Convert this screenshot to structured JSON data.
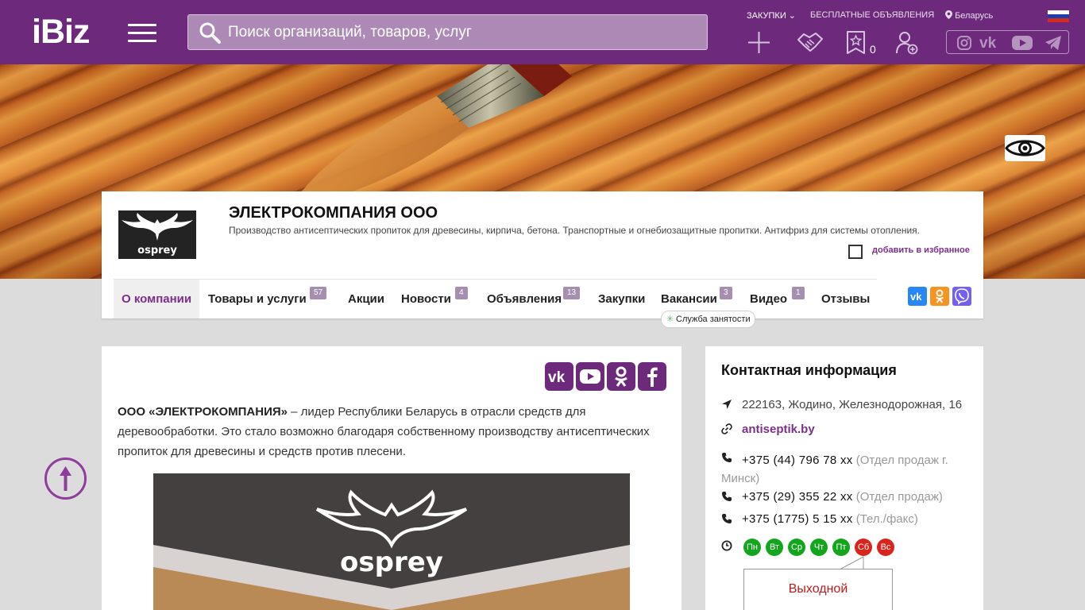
{
  "header": {
    "logo": "iBiz",
    "search_placeholder": "Поиск организаций, товаров, услуг",
    "zakupki": "ЗАКУПКИ",
    "free_ads": "БЕСПЛАТНЫЕ ОБЪЯВЛЕНИЯ",
    "region": "Беларусь",
    "favorites_count": "0",
    "social_icons": [
      "instagram-icon",
      "vk-icon",
      "youtube-icon",
      "telegram-icon"
    ]
  },
  "company": {
    "name": "ЭЛЕКТРОКОМПАНИЯ ООО",
    "logo_text": "osprey",
    "description": "Производство антисептических пропиток для древесины, кирпича, бетона. Транспортные и огнебиозащитные пропитки. Антифриз для системы отопления.",
    "add_favorite": "добавить в избранное",
    "tabs": [
      {
        "label": "О компании",
        "badge": ""
      },
      {
        "label": "Товары и услуги",
        "badge": "57"
      },
      {
        "label": "Акции",
        "badge": ""
      },
      {
        "label": "Новости",
        "badge": "4"
      },
      {
        "label": "Объявления",
        "badge": "13"
      },
      {
        "label": "Закупки",
        "badge": ""
      },
      {
        "label": "Вакансии",
        "badge": "3"
      },
      {
        "label": "Видео",
        "badge": "1"
      },
      {
        "label": "Отзывы",
        "badge": ""
      }
    ],
    "employment_service": "Служба занятости"
  },
  "about": {
    "intro_bold": "ООО «ЭЛЕКТРОКОМПАНИЯ»",
    "intro_rest": " – лидер Республики Беларусь в отрасли средств для деревообработки. Это стало возможно благодаря собственному производству антисептических пропиток для древесины и средств против плесени.",
    "image_text": "osprey"
  },
  "contacts": {
    "title": "Контактная информация",
    "address": "222163, Жодино, Железнодорожная, 16",
    "site": "antiseptik.by",
    "phones": [
      {
        "number": "+375 (44) 796 78 xx",
        "note": "(Отдел продаж г. Минск)"
      },
      {
        "number": "+375 (29) 355 22 xx",
        "note": "(Отдел продаж)"
      },
      {
        "number": "+375 (1775) 5 15 xx",
        "note": "(Тел./факс)"
      }
    ],
    "days": [
      {
        "label": "Пн",
        "status": "work"
      },
      {
        "label": "Вт",
        "status": "work"
      },
      {
        "label": "Ср",
        "status": "work"
      },
      {
        "label": "Чт",
        "status": "work"
      },
      {
        "label": "Пт",
        "status": "work"
      },
      {
        "label": "Сб",
        "status": "off"
      },
      {
        "label": "Вс",
        "status": "off"
      }
    ],
    "tooltip": "Выходной"
  },
  "colors": {
    "brand": "#6d2a7c",
    "work_day": "#13a51d",
    "day_off": "#d9241c"
  }
}
